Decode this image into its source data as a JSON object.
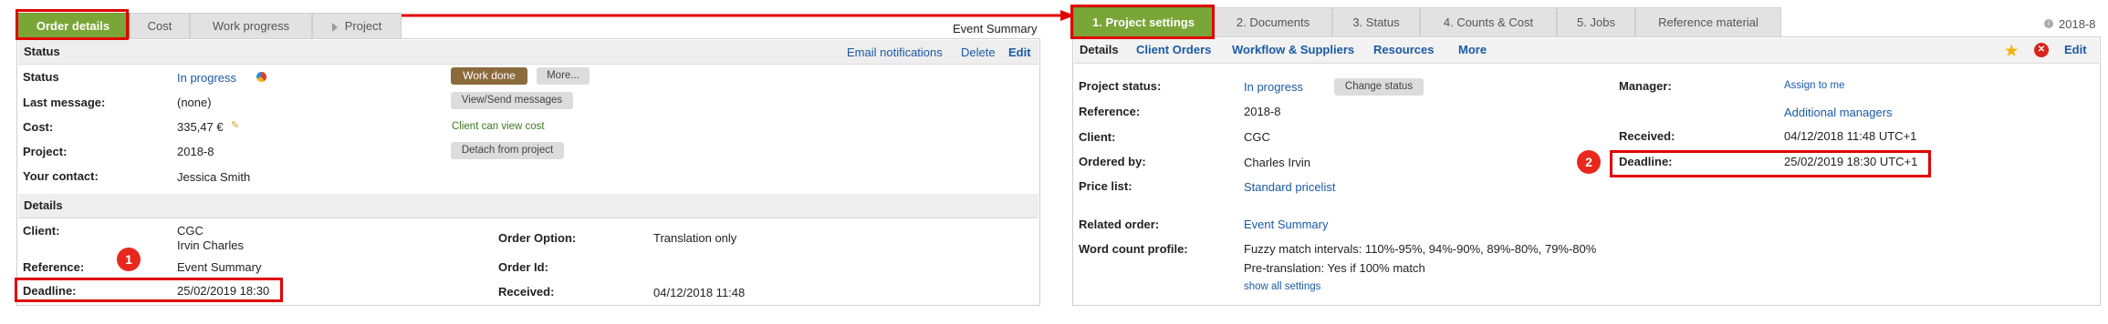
{
  "left": {
    "tabs": [
      {
        "label": "Order details"
      },
      {
        "label": "Cost"
      },
      {
        "label": "Work progress"
      },
      {
        "label": "Project"
      }
    ],
    "title_right": "Event Summary",
    "status_section": {
      "title": "Status",
      "actions": {
        "email": "Email notifications",
        "delete": "Delete",
        "edit": "Edit"
      },
      "fields": {
        "status_label": "Status",
        "status_value": "In progress",
        "last_message_label": "Last message:",
        "last_message_value": "(none)",
        "cost_label": "Cost:",
        "cost_value": "335,47 €",
        "project_label": "Project:",
        "project_value": "2018-8",
        "contact_label": "Your contact:",
        "contact_value": "Jessica Smith"
      },
      "buttons": {
        "work_done": "Work done",
        "more": "More...",
        "view_send": "View/Send messages",
        "client_view_cost": "Client can view cost",
        "detach": "Detach from project"
      }
    },
    "details_section": {
      "title": "Details",
      "client_label": "Client:",
      "client_line1": "CGC",
      "client_line2": "Irvin Charles",
      "reference_label": "Reference:",
      "reference_value": "Event Summary",
      "deadline_label": "Deadline:",
      "deadline_value": "25/02/2019 18:30",
      "order_option_label": "Order Option:",
      "order_option_value": "Translation only",
      "order_id_label": "Order Id:",
      "received_label": "Received:",
      "received_value": "04/12/2018 11:48"
    },
    "badge": "1"
  },
  "right": {
    "tabs": [
      {
        "label": "1. Project settings"
      },
      {
        "label": "2. Documents"
      },
      {
        "label": "3. Status"
      },
      {
        "label": "4. Counts & Cost"
      },
      {
        "label": "5. Jobs"
      },
      {
        "label": "Reference material"
      }
    ],
    "project_id": "2018-8",
    "subnav": {
      "details": "Details",
      "client_orders": "Client Orders",
      "workflow": "Workflow & Suppliers",
      "resources": "Resources",
      "more": "More",
      "edit": "Edit"
    },
    "fields": {
      "status_label": "Project status:",
      "status_value": "In progress",
      "change_status": "Change status",
      "reference_label": "Reference:",
      "reference_value": "2018-8",
      "client_label": "Client:",
      "client_value": "CGC",
      "ordered_by_label": "Ordered by:",
      "ordered_by_value": "Charles Irvin",
      "price_list_label": "Price list:",
      "price_list_value": "Standard pricelist",
      "related_order_label": "Related order:",
      "related_order_value": "Event Summary",
      "word_count_label": "Word count profile:",
      "word_count_line1": "Fuzzy match intervals: 110%-95%, 94%-90%, 89%-80%, 79%-80%",
      "word_count_line2": "Pre-translation: Yes if 100% match",
      "show_all": "show all settings",
      "manager_label": "Manager:",
      "assign_to_me": "Assign to me",
      "additional_managers": "Additional managers",
      "received_label": "Received:",
      "received_value": "04/12/2018 11:48 UTC+1",
      "deadline_label": "Deadline:",
      "deadline_value": "25/02/2019 18:30 UTC+1"
    },
    "badge": "2"
  },
  "colors": {
    "accent_green": "#7aa638",
    "link_blue": "#1a5aa6",
    "highlight_red": "#e00000",
    "work_done_brown": "#8b6a3c"
  }
}
